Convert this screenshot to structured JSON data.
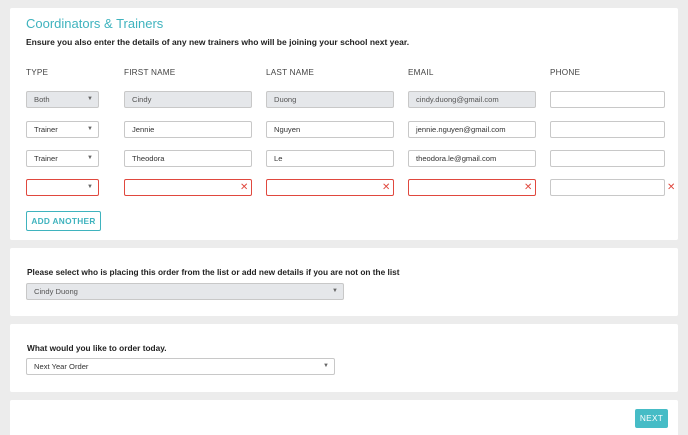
{
  "coordinators": {
    "title": "Coordinators & Trainers",
    "subtitle": "Ensure you also enter the details of any new trainers who will be joining your school next year.",
    "columns": {
      "type": "TYPE",
      "first_name": "FIRST NAME",
      "last_name": "LAST NAME",
      "email": "EMAIL",
      "phone": "PHONE"
    },
    "rows": [
      {
        "type": "Both",
        "first_name": "Cindy",
        "last_name": "Duong",
        "email": "cindy.duong@gmail.com",
        "phone": ""
      },
      {
        "type": "Trainer",
        "first_name": "Jennie",
        "last_name": "Nguyen",
        "email": "jennie.nguyen@gmail.com",
        "phone": ""
      },
      {
        "type": "Trainer",
        "first_name": "Theodora",
        "last_name": "Le",
        "email": "theodora.le@gmail.com",
        "phone": ""
      },
      {
        "type": "",
        "first_name": "",
        "last_name": "",
        "email": "",
        "phone": ""
      }
    ],
    "add_another_label": "ADD ANOTHER"
  },
  "order_placer": {
    "question": "Please select who is placing this order from the list or add new details if you are not on the list",
    "selected": "Cindy Duong"
  },
  "order_type": {
    "question": "What would you like to order today.",
    "selected": "Next Year Order"
  },
  "footer": {
    "next_label": "NEXT"
  },
  "icons": {
    "dropdown": "chevron-down-icon",
    "error": "error-x-icon"
  },
  "colors": {
    "accent": "#3fb3be",
    "error": "#e0483e"
  }
}
